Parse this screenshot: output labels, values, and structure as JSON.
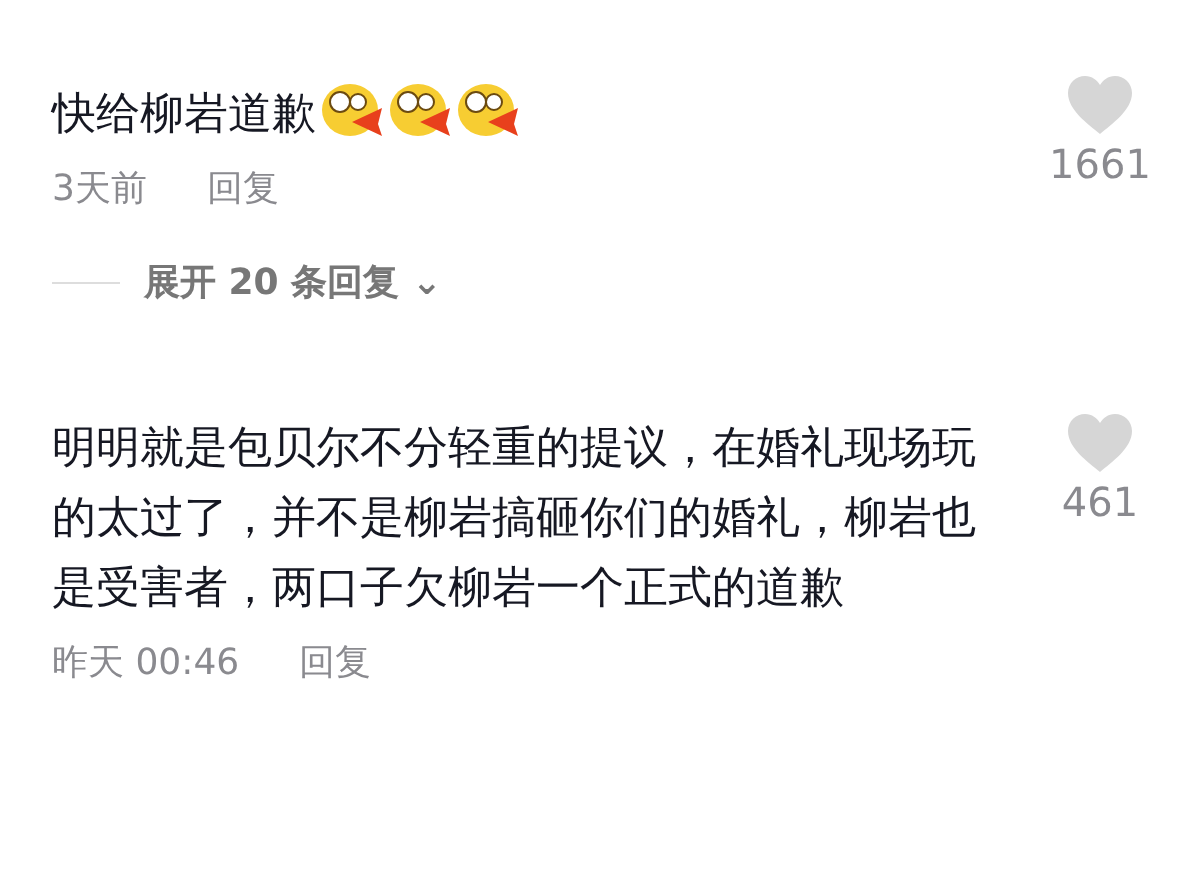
{
  "comments": [
    {
      "text": "快给柳岩道歉",
      "emojis": [
        {
          "kind": "spit-face"
        },
        {
          "kind": "spit-face"
        },
        {
          "kind": "spit-face"
        }
      ],
      "time": "3天前",
      "reply": "回复",
      "liked": false,
      "likes": "1661",
      "expand": {
        "label": "展开 20 条回复",
        "icon": "⌄"
      }
    },
    {
      "text": "明明就是包贝尔不分轻重的提议，在婚礼现场玩的太过了，并不是柳岩搞砸你们的婚礼，柳岩也是受害者，两口子欠柳岩一个正式的道歉",
      "time": "昨天 00:46",
      "reply": "回复",
      "liked": false,
      "likes": "461"
    }
  ]
}
